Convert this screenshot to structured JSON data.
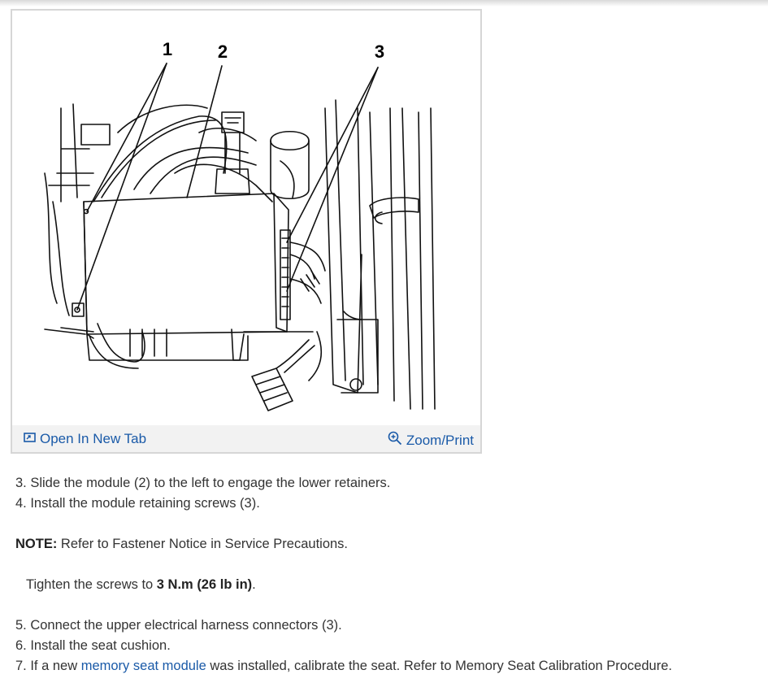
{
  "figure": {
    "callouts": [
      "1",
      "2",
      "3"
    ],
    "open_tab_label": "Open In New Tab",
    "zoom_label": "Zoom/Print"
  },
  "steps": {
    "step3": "3. Slide the module (2) to the left to engage the lower retainers.",
    "step4": "4. Install the module retaining screws (3).",
    "note_label": "NOTE:",
    "note_text": " Refer to Fastener Notice in Service Precautions.",
    "tighten_prefix": "Tighten the screws to ",
    "tighten_value": "3 N.m (26 lb in)",
    "tighten_suffix": ".",
    "step5": "5. Connect the upper electrical harness connectors (3).",
    "step6": "6. Install the seat cushion.",
    "step7_prefix": "7. If a new ",
    "step7_link": "memory seat module",
    "step7_suffix": " was installed, calibrate the seat. Refer to Memory Seat Calibration Procedure."
  },
  "icons": {
    "open_tab": "open-new-tab-icon",
    "zoom": "zoom-in-icon"
  },
  "colors": {
    "link": "#1a5aa8",
    "bar_bg": "#f2f2f2",
    "border": "#d6d6d6"
  }
}
